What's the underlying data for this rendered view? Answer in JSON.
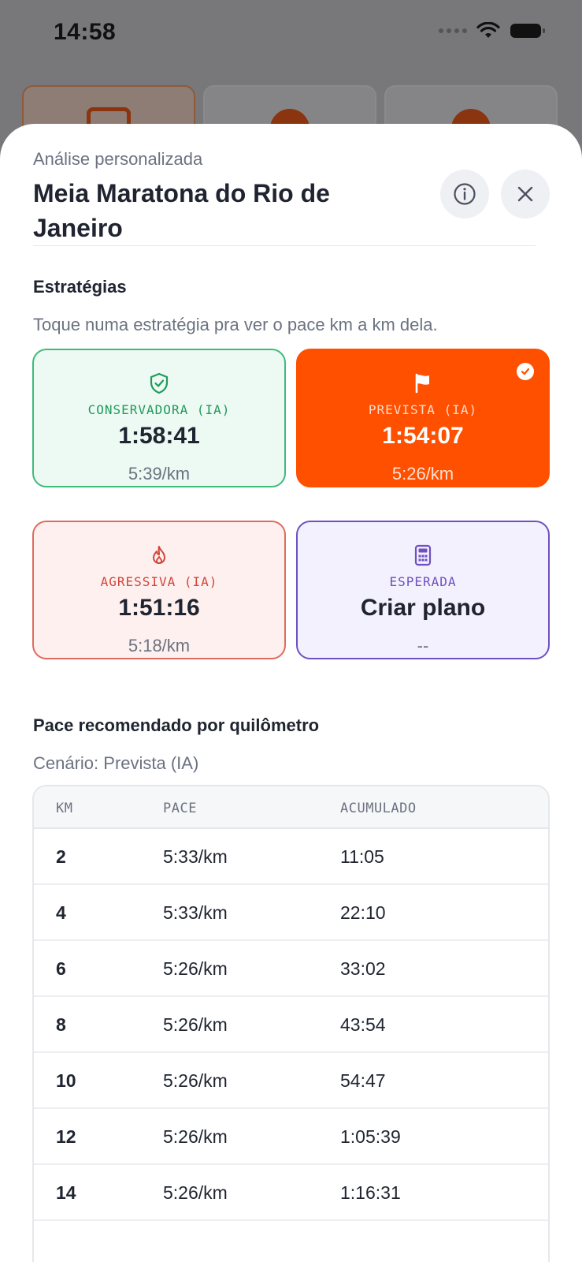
{
  "status_bar": {
    "time": "14:58"
  },
  "sheet": {
    "subtitle": "Análise personalizada",
    "title": "Meia Maratona do Rio de Janeiro"
  },
  "strategies": {
    "title": "Estratégias",
    "subtitle": "Toque numa estratégia pra ver o pace km a km dela.",
    "items": [
      {
        "label": "CONSERVADORA (IA)",
        "time": "1:58:41",
        "pace": "5:39/km",
        "icon": "shield-check-icon",
        "color": "#1f9a5a"
      },
      {
        "label": "PREVISTA (IA)",
        "time": "1:54:07",
        "pace": "5:26/km",
        "icon": "flag-icon",
        "color": "#ff5000",
        "selected": true
      },
      {
        "label": "AGRESSIVA (IA)",
        "time": "1:51:16",
        "pace": "5:18/km",
        "icon": "flame-icon",
        "color": "#d2453a"
      },
      {
        "label": "ESPERADA",
        "time": "Criar plano",
        "pace": "--",
        "icon": "calculator-icon",
        "color": "#6f4fc2"
      }
    ]
  },
  "pace_table": {
    "title": "Pace recomendado por quilômetro",
    "scenario": "Cenário: Prevista (IA)",
    "headers": [
      "KM",
      "PACE",
      "ACUMULADO"
    ],
    "rows": [
      [
        "2",
        "5:33/km",
        "11:05"
      ],
      [
        "4",
        "5:33/km",
        "22:10"
      ],
      [
        "6",
        "5:26/km",
        "33:02"
      ],
      [
        "8",
        "5:26/km",
        "43:54"
      ],
      [
        "10",
        "5:26/km",
        "54:47"
      ],
      [
        "12",
        "5:26/km",
        "1:05:39"
      ],
      [
        "14",
        "5:26/km",
        "1:16:31"
      ]
    ]
  }
}
